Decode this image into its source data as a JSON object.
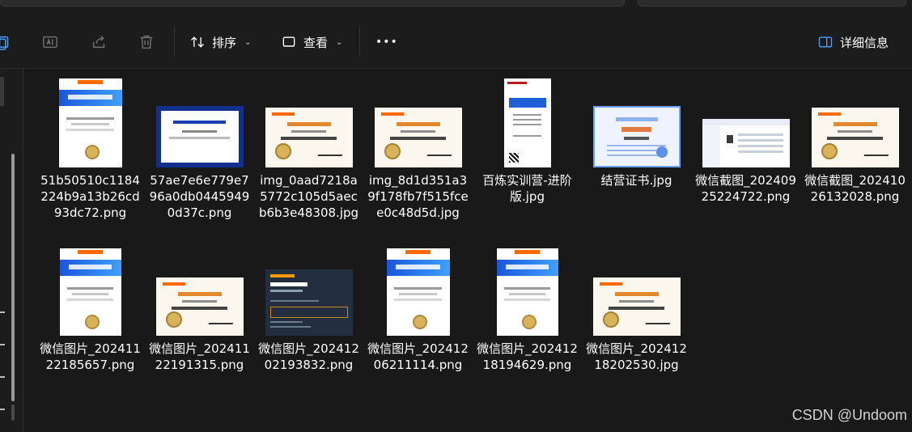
{
  "toolbar": {
    "icons": [
      "copy-icon",
      "rename-icon",
      "share-icon",
      "delete-icon"
    ],
    "sort_label": "排序",
    "view_label": "查看",
    "more_label": "•••",
    "details_label": "详细信息"
  },
  "files": [
    {
      "name": "51b50510c1184224b9a13b26cd93dc72.png",
      "thumb": "port-blue"
    },
    {
      "name": "57ae7e6e779e796a0db04459490d37c.png",
      "thumb": "baidu"
    },
    {
      "name": "img_0aad7218a5772c105d5aecb6b3e48308.jpg",
      "thumb": "alibaba"
    },
    {
      "name": "img_8d1d351a39f178fb7f515fcee0c48d5d.jpg",
      "thumb": "alibaba"
    },
    {
      "name": "百炼实训营-进阶版.jpg",
      "thumb": "phone"
    },
    {
      "name": "结营证书.jpg",
      "thumb": "blue-cert"
    },
    {
      "name": "微信截图_20240925224722.png",
      "thumb": "screenshot"
    },
    {
      "name": "微信截图_20241026132028.png",
      "thumb": "alibaba"
    },
    {
      "name": "微信图片_20241122185657.png",
      "thumb": "port-blue"
    },
    {
      "name": "微信图片_20241122191315.png",
      "thumb": "alibaba"
    },
    {
      "name": "微信图片_20241202193832.png",
      "thumb": "aws-dark"
    },
    {
      "name": "微信图片_20241206211114.png",
      "thumb": "port-blue"
    },
    {
      "name": "微信图片_20241218194629.png",
      "thumb": "port-blue"
    },
    {
      "name": "微信图片_20241218202530.jpg",
      "thumb": "alibaba"
    }
  ],
  "watermark": "CSDN @Undoom",
  "colors": {
    "background": "#191919",
    "toolbar": "#1c1c1c",
    "text": "#ffffff",
    "icon_disabled": "#6f6f6f",
    "accent_orange": "#ff6a00",
    "accent_blue": "#1a56db"
  }
}
